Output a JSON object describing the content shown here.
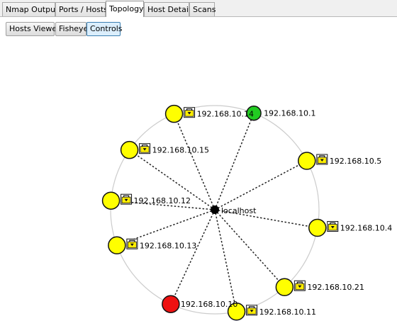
{
  "tabs": [
    {
      "label": "Nmap Output",
      "active": false
    },
    {
      "label": "Ports / Hosts",
      "active": false
    },
    {
      "label": "Topology",
      "active": true
    },
    {
      "label": "Host Details",
      "active": false
    },
    {
      "label": "Scans",
      "active": false
    }
  ],
  "toolbar": {
    "hosts_viewer_label": "Hosts Viewer",
    "fisheye_label": "Fisheye",
    "controls_label": "Controls"
  },
  "topology": {
    "center": {
      "label": "localhost"
    },
    "hosts": [
      {
        "label": "192.168.10.1",
        "status_color": "#22cc22",
        "icon": "none"
      },
      {
        "label": "192.168.10.5",
        "status_color": "#ffff00",
        "icon": "lock-icon"
      },
      {
        "label": "192.168.10.4",
        "status_color": "#ffff00",
        "icon": "lock-icon"
      },
      {
        "label": "192.168.10.21",
        "status_color": "#ffff00",
        "icon": "lock-icon"
      },
      {
        "label": "192.168.10.11",
        "status_color": "#ffff00",
        "icon": "lock-icon"
      },
      {
        "label": "192.168.10.10",
        "status_color": "#ee1111",
        "icon": "none"
      },
      {
        "label": "192.168.10.13",
        "status_color": "#ffff00",
        "icon": "lock-icon"
      },
      {
        "label": "192.168.10.12",
        "status_color": "#ffff00",
        "icon": "lock-icon"
      },
      {
        "label": "192.168.10.15",
        "status_color": "#ffff00",
        "icon": "lock-icon"
      },
      {
        "label": "192.168.10.14",
        "status_color": "#ffff00",
        "icon": "lock-icon"
      }
    ]
  }
}
